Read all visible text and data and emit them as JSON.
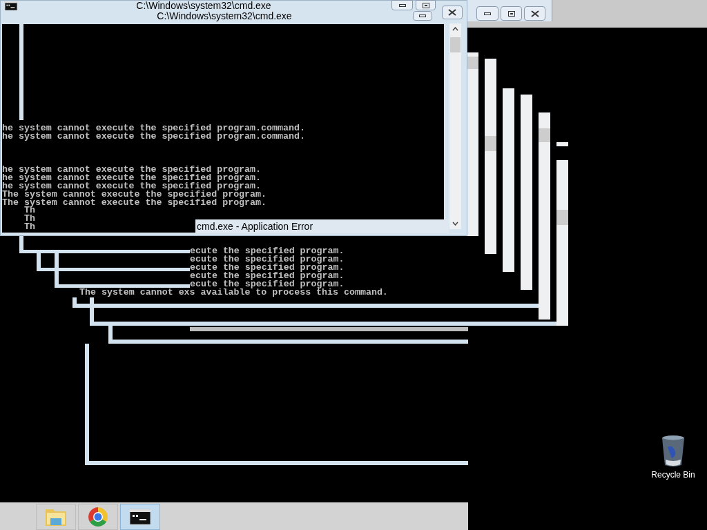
{
  "console_window": {
    "title": "C:\\Windows\\system32\\cmd.exe"
  },
  "ghost_window": {
    "title": "C:\\Windows\\system32\\cmd.exe"
  },
  "console_output": [
    {
      "lines": [
        "he system cannot execute the specified program.command.",
        "he system cannot execute the specified program.command."
      ]
    },
    {
      "lines": [
        "he system cannot execute the specified program.",
        "he system cannot execute the specified program.",
        "he system cannot execute the specified program.",
        "The system cannot execute the specified program.",
        "The system cannot execute the specified program."
      ]
    }
  ],
  "partial_lines": [
    "Th",
    "Th",
    "Th"
  ],
  "error_dialog": {
    "title": "cmd.exe - Application Error"
  },
  "trail_output": [
    "ecute the specified program.",
    "ecute the specified program.",
    "ecute the specified program.",
    "ecute the specified program.",
    "ecute the specified program.",
    "The system cannot exs available to process this command."
  ],
  "taskbar": {
    "items": [
      {
        "kind": "folder",
        "selected": false
      },
      {
        "kind": "browser",
        "selected": false
      },
      {
        "kind": "console",
        "selected": true
      }
    ]
  },
  "desktop_icons": [
    {
      "label": "Recycle Bin"
    }
  ]
}
